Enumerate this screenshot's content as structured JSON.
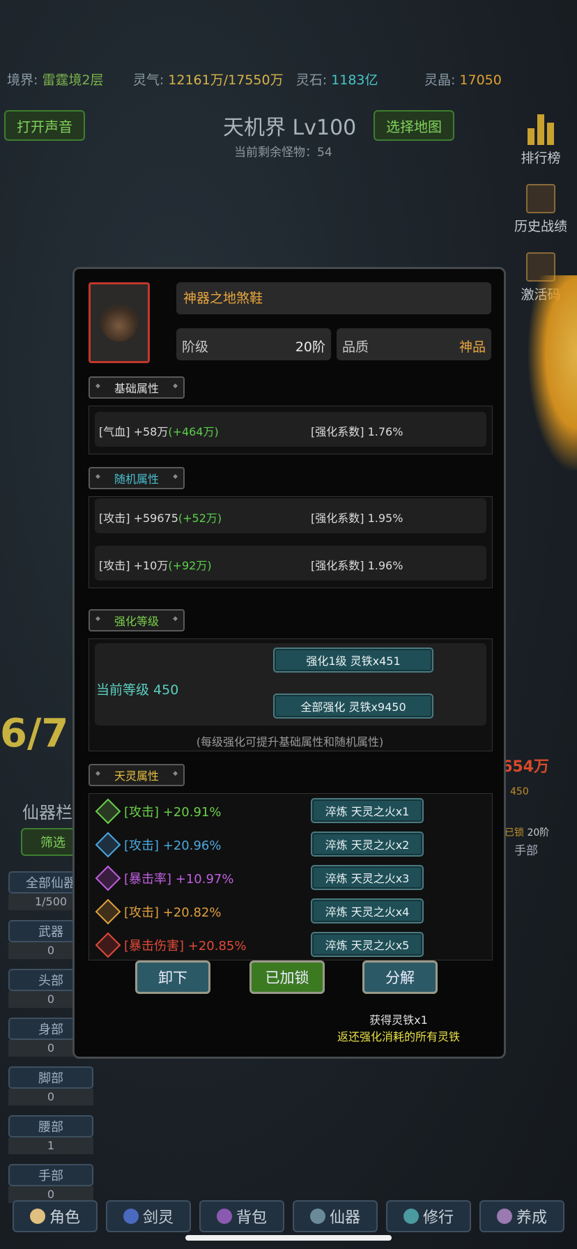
{
  "topbar": {
    "realm_label": "境界:",
    "realm_value": "雷霆境2层",
    "qi_label": "灵气:",
    "qi_value": "12161万/17550万",
    "stone_label": "灵石:",
    "stone_value": "1183亿",
    "crystal_label": "灵晶:",
    "crystal_value": "17050"
  },
  "sound_button": "打开声音",
  "map": {
    "title": "天机界 Lv100",
    "remaining": "当前剩余怪物：54",
    "select_button": "选择地图"
  },
  "side": {
    "ranking": "排行榜",
    "history": "历史战绩",
    "code": "激活码"
  },
  "background_texts": {
    "big_number": "6/7",
    "damage": "654万",
    "tab_label": "仙器栏",
    "filter": "筛选",
    "right_slot_level": "450",
    "right_slot_locked": "已锁",
    "right_slot_rank": "20阶",
    "right_slot_name": "手部"
  },
  "left_panel": [
    {
      "label": "全部仙器",
      "value": "1/500"
    },
    {
      "label": "武器",
      "value": "0"
    },
    {
      "label": "头部",
      "value": "0"
    },
    {
      "label": "身部",
      "value": "0"
    },
    {
      "label": "脚部",
      "value": "0"
    },
    {
      "label": "腰部",
      "value": "1"
    },
    {
      "label": "手部",
      "value": "0"
    }
  ],
  "modal": {
    "item_name": "神器之地煞鞋",
    "rank_label": "阶级",
    "rank_value": "20阶",
    "quality_label": "品质",
    "quality_value": "神品",
    "base_section": "基础属性",
    "base_attr": {
      "left": "[气血] +58万",
      "bonus": "(+464万)",
      "right": "[强化系数] 1.76%"
    },
    "random_section": "随机属性",
    "random_attrs": [
      {
        "left": "[攻击] +59675",
        "bonus": "(+52万)",
        "right": "[强化系数] 1.95%"
      },
      {
        "left": "[攻击] +10万",
        "bonus": "(+92万)",
        "right": "[强化系数] 1.96%"
      }
    ],
    "enhance_section": "强化等级",
    "current_level": "当前等级 450",
    "enhance_one": "强化1级 灵铁x451",
    "enhance_all": "全部强化 灵铁x9450",
    "enhance_note": "(每级强化可提升基础属性和随机属性)",
    "spirit_section": "天灵属性",
    "spirit_attrs": [
      {
        "text": "[攻击] +20.91%",
        "color": "#6ad04a",
        "button": "淬炼 天灵之火x1"
      },
      {
        "text": "[攻击] +20.96%",
        "color": "#4aa8e0",
        "button": "淬炼 天灵之火x2"
      },
      {
        "text": "[暴击率] +10.97%",
        "color": "#c060e0",
        "button": "淬炼 天灵之火x3"
      },
      {
        "text": "[攻击] +20.82%",
        "color": "#e0a040",
        "button": "淬炼 天灵之火x4"
      },
      {
        "text": "[暴击伤害] +20.85%",
        "color": "#e04a3a",
        "button": "淬炼 天灵之火x5"
      }
    ],
    "unequip": "卸下",
    "locked": "已加锁",
    "decompose": "分解",
    "decompose_note1": "获得灵铁x1",
    "decompose_note2": "返还强化消耗的所有灵铁"
  },
  "bottom_nav": [
    "角色",
    "剑灵",
    "背包",
    "仙器",
    "修行",
    "养成"
  ]
}
